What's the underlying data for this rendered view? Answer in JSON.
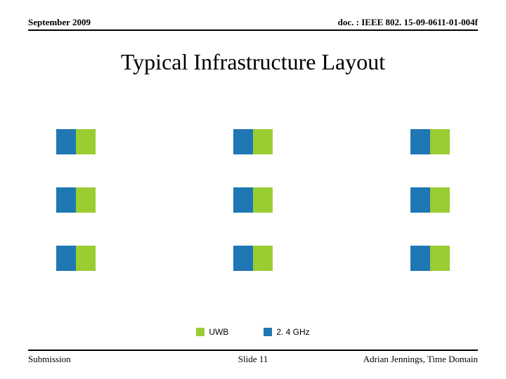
{
  "header": {
    "date": "September 2009",
    "doc": "doc. : IEEE 802. 15-09-0611-01-004f"
  },
  "title": "Typical Infrastructure Layout",
  "colors": {
    "uwb": "#9acd32",
    "ghz": "#1f77b4"
  },
  "legend": {
    "uwb": "UWB",
    "ghz": "2. 4 GHz"
  },
  "footer": {
    "left": "Submission",
    "center": "Slide 11",
    "right": "Adrian Jennings, Time Domain"
  },
  "grid": {
    "rows": 3,
    "cols": 3,
    "pair": [
      "blue",
      "green"
    ]
  }
}
